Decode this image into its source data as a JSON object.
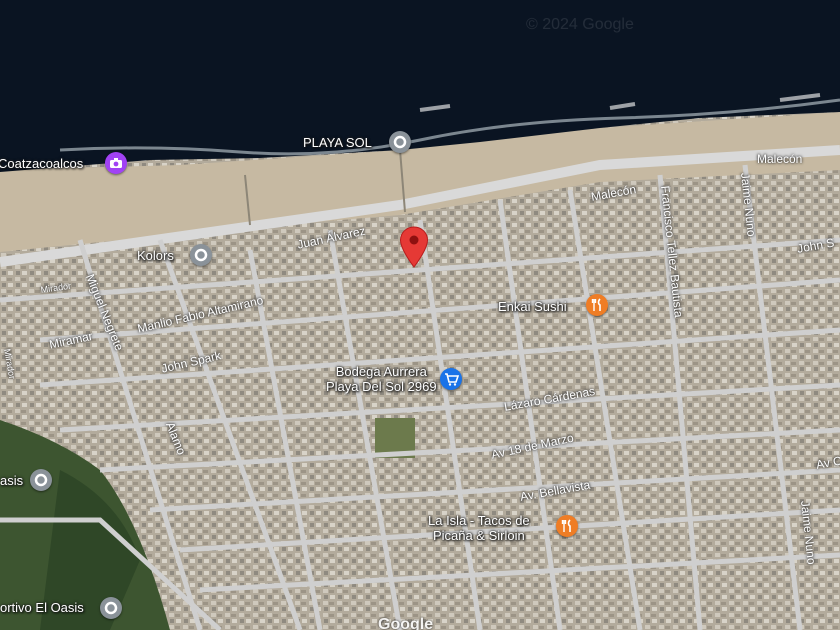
{
  "copyright": "© 2024 Google",
  "brand": "Google",
  "places": {
    "playa_sol": "PLAYA SOL",
    "coatzacoalcos": "Coatzacoalcos",
    "kolors": "Kolors",
    "enkai_sushi": "Enkai Sushi",
    "bodega_line1": "Bodega Aurrera",
    "bodega_line2": "Playa Del Sol 2969",
    "la_isla_line1": "La Isla - Tacos de",
    "la_isla_line2": "Picaña & Sirloin",
    "oasis": "asis",
    "deportivo": "ortivo El Oasis"
  },
  "streets": {
    "malecon_1": "Malecón",
    "malecon_2": "Malecón",
    "juan_alvarez": "Juan Álvarez",
    "manlio": "Manlio Fabio Altamirano",
    "miramar": "Miramar",
    "miguel_negrete": "Miguel Negrete",
    "john_spark": "John Spark",
    "john_s_right": "John S",
    "francisco": "Francisco Tellez Bautista",
    "jaime_nuno_1": "Jaime Nuno",
    "jaime_nuno_2": "Jaime Nuno",
    "lazaro": "Lázaro Cárdenas",
    "av18": "Av 18 de Marzo",
    "bellavista": "Av. Bellavista",
    "alamo": "Alamo",
    "mirador_1": "Mirador",
    "mirador_2": "Mirador",
    "av_c": "Av C"
  },
  "icons": {
    "pin": "location-pin-icon",
    "place_marker": "place-marker-icon",
    "restaurant": "fork-knife-icon",
    "shopping": "shopping-cart-icon",
    "camera": "camera-icon"
  },
  "colors": {
    "sea": "#0a1422",
    "beach": "#c9bda7",
    "urban": "#b7b0a2",
    "road": "#d2d2d2",
    "pin": "#e53935",
    "place_marker": "#8a9299",
    "restaurant": "#ef7d25",
    "shopping": "#1a73e8",
    "camera": "#a142f4"
  }
}
